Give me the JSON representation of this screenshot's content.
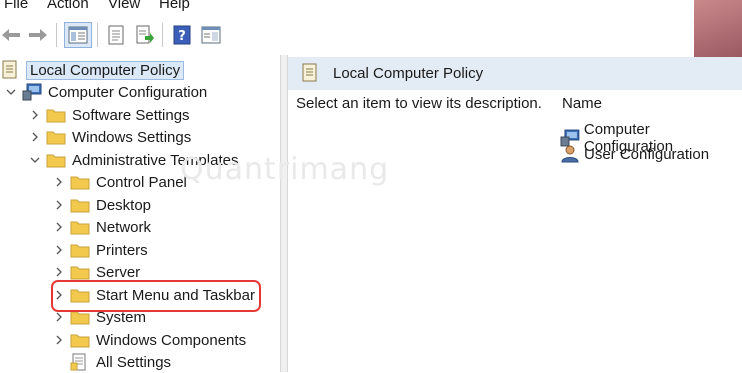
{
  "menu": [
    "File",
    "Action",
    "View",
    "Help"
  ],
  "watermark": "Quantrimang",
  "tree": {
    "root": "Local Computer Policy",
    "computer_config": "Computer Configuration",
    "software_settings": "Software Settings",
    "windows_settings": "Windows Settings",
    "admin_templates": "Administrative Templates",
    "children": [
      "Control Panel",
      "Desktop",
      "Network",
      "Printers",
      "Server",
      "Start Menu and Taskbar",
      "System",
      "Windows Components",
      "All Settings"
    ]
  },
  "right": {
    "title": "Local Computer Policy",
    "description": "Select an item to view its description.",
    "column_name": "Name",
    "items": [
      "Computer Configuration",
      "User Configuration"
    ]
  },
  "colors": {
    "highlight": "#e53935",
    "selection": "#dbe8f7",
    "folder": "#f2c94c"
  }
}
